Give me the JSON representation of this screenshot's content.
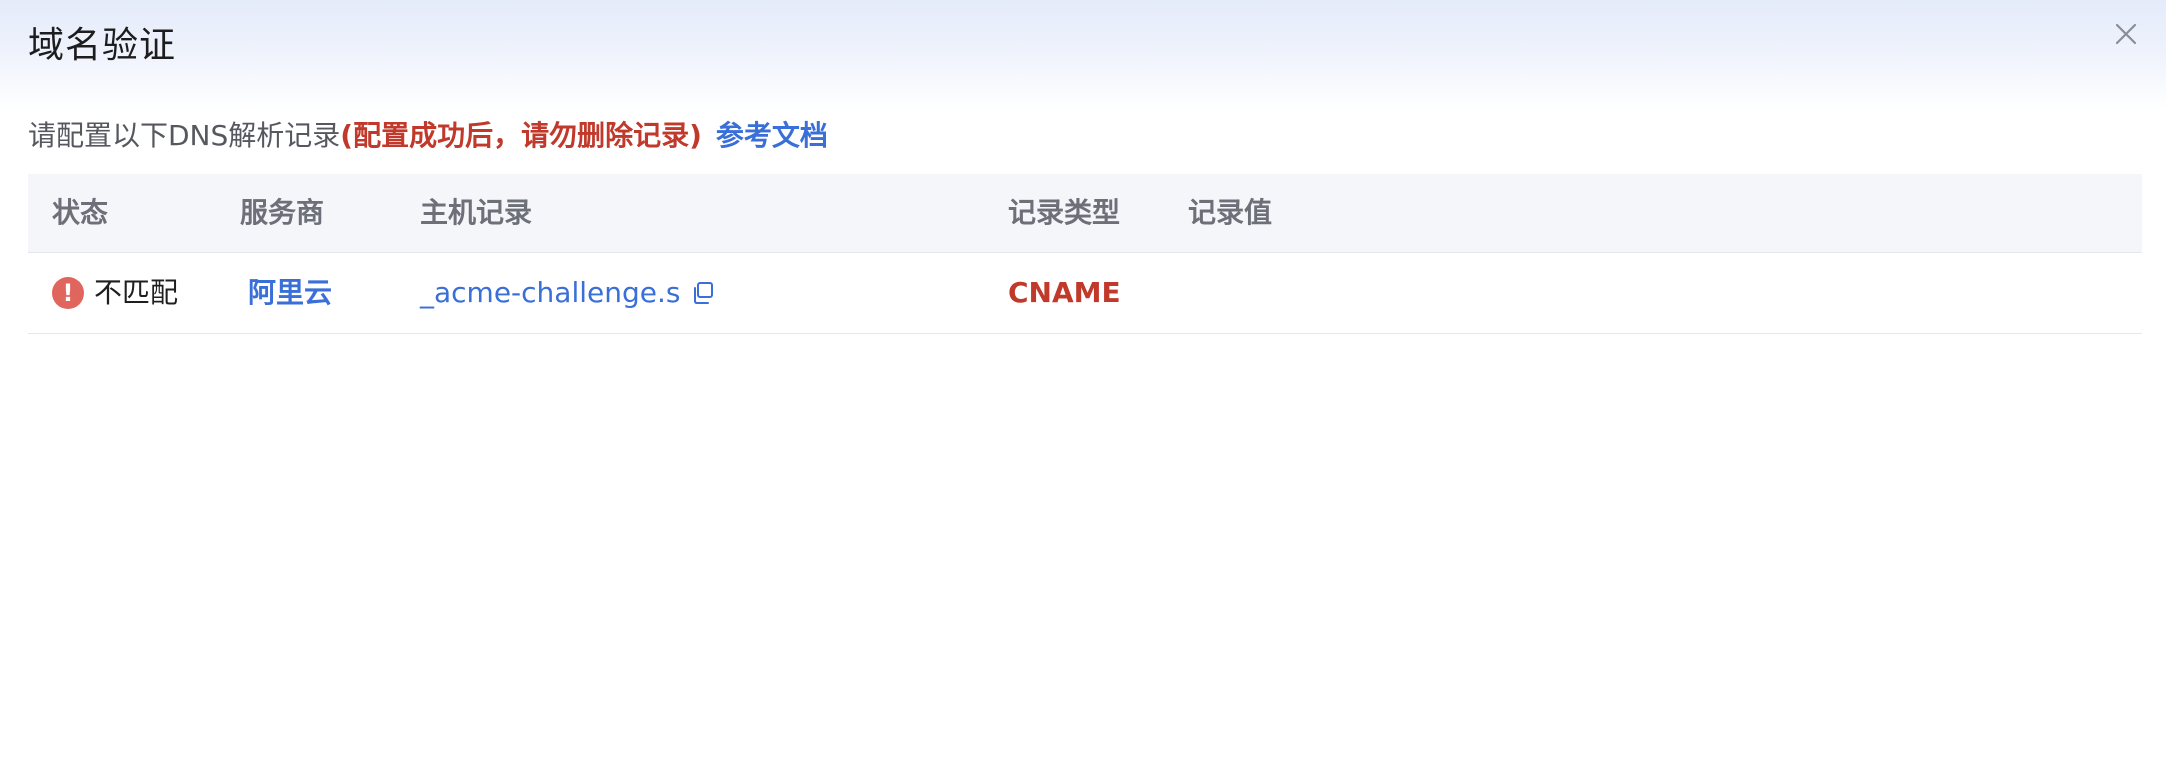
{
  "dialog": {
    "title": "域名验证",
    "close_icon": "close-icon"
  },
  "hint": {
    "main": "请配置以下DNS解析记录",
    "warning": "(配置成功后，请勿删除记录)",
    "link": "参考文档"
  },
  "table": {
    "columns": [
      "状态",
      "服务商",
      "主机记录",
      "记录类型",
      "记录值"
    ],
    "rows": [
      {
        "status_icon": "error-icon",
        "status_icon_glyph": "!",
        "status": "不匹配",
        "provider": "阿里云",
        "host": "_acme-challenge.s",
        "copy_icon": "copy-icon",
        "type": "CNAME",
        "value": ""
      }
    ]
  },
  "colors": {
    "link": "#3a6fd8",
    "warning": "#c0392b",
    "error_icon": "#e0655c",
    "header_gradient_top": "#e4ebfa"
  }
}
